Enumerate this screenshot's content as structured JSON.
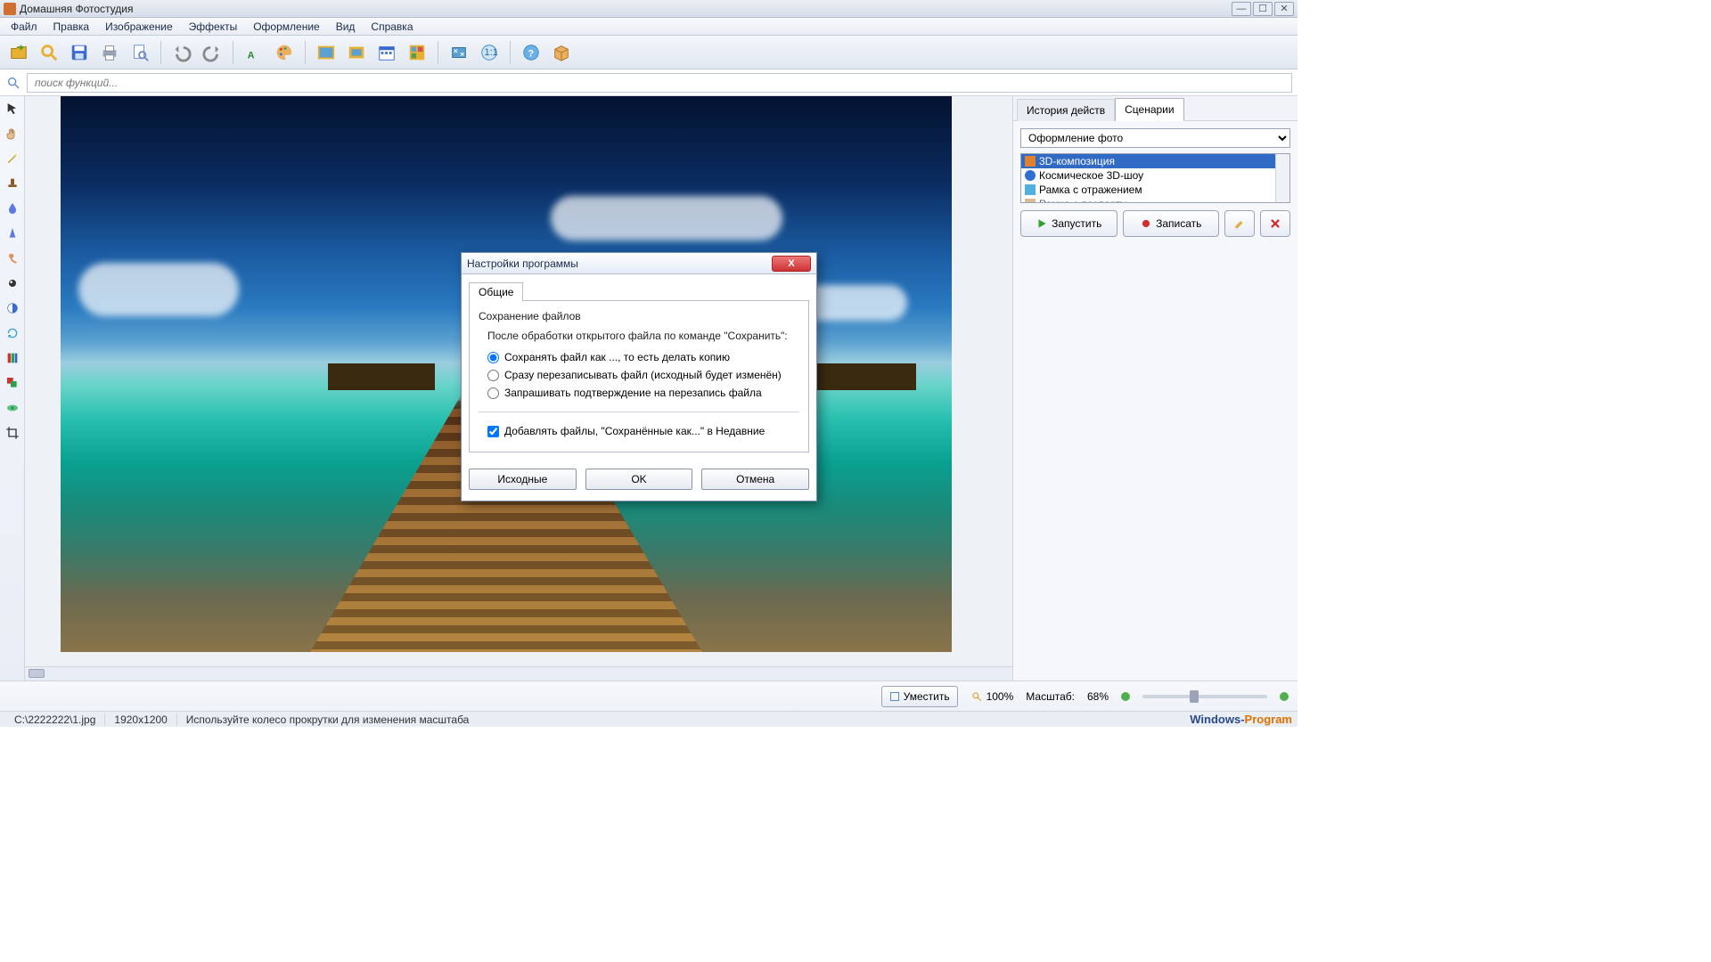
{
  "window": {
    "title": "Домашняя Фотостудия"
  },
  "menu": {
    "file": "Файл",
    "edit": "Правка",
    "image": "Изображение",
    "effects": "Эффекты",
    "design": "Оформление",
    "view": "Вид",
    "help": "Справка"
  },
  "search": {
    "placeholder": "поиск функций..."
  },
  "right": {
    "tab_history": "История действ",
    "tab_scenarios": "Сценарии",
    "select_value": "Оформление фото",
    "items": {
      "0": "3D-композиция",
      "1": "Космическое 3D-шоу",
      "2": "Рамка с отражением",
      "3": "Рамка с паспарту"
    },
    "run": "Запустить",
    "record": "Записать"
  },
  "zoom": {
    "fit": "Уместить",
    "hundred": "100%",
    "scale_label": "Масштаб:",
    "scale_value": "68%"
  },
  "status": {
    "path": "C:\\2222222\\1.jpg",
    "dims": "1920x1200",
    "hint": "Используйте колесо прокрутки для изменения масштаба",
    "wm1": "Windows-",
    "wm2": "Program"
  },
  "dialog": {
    "title": "Настройки программы",
    "tab_general": "Общие",
    "group": "Сохранение файлов",
    "info": "После обработки открытого файла по команде \"Сохранить\":",
    "r1": "Сохранять файл как ..., то есть делать копию",
    "r2": "Сразу перезаписывать файл (исходный будет изменён)",
    "r3": "Запрашивать подтверждение на перезапись файла",
    "chk": "Добавлять файлы, \"Сохранённые как...\" в Недавние",
    "btn_defaults": "Исходные",
    "btn_ok": "OK",
    "btn_cancel": "Отмена"
  }
}
